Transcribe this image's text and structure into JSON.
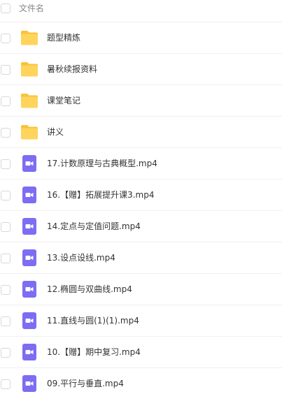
{
  "header": {
    "column_label": "文件名"
  },
  "items": [
    {
      "type": "folder",
      "name": "题型精炼"
    },
    {
      "type": "folder",
      "name": "暑秋续报资料"
    },
    {
      "type": "folder",
      "name": "课堂笔记"
    },
    {
      "type": "folder",
      "name": "讲义"
    },
    {
      "type": "video",
      "name": "17.计数原理与古典概型.mp4"
    },
    {
      "type": "video",
      "name": "16.【赠】拓展提升课3.mp4"
    },
    {
      "type": "video",
      "name": "14.定点与定值问题.mp4"
    },
    {
      "type": "video",
      "name": "13.设点设线.mp4"
    },
    {
      "type": "video",
      "name": "12.椭圆与双曲线.mp4"
    },
    {
      "type": "video",
      "name": "11.直线与圆(1)(1).mp4"
    },
    {
      "type": "video",
      "name": "10.【赠】期中复习.mp4"
    },
    {
      "type": "video",
      "name": "09.平行与垂直.mp4"
    }
  ],
  "colors": {
    "folder": "#ffd45c",
    "folder_tab": "#f7c338",
    "video": "#7c6df2",
    "checkbox_border": "#d4d7de",
    "divider": "#f0f0f2"
  }
}
